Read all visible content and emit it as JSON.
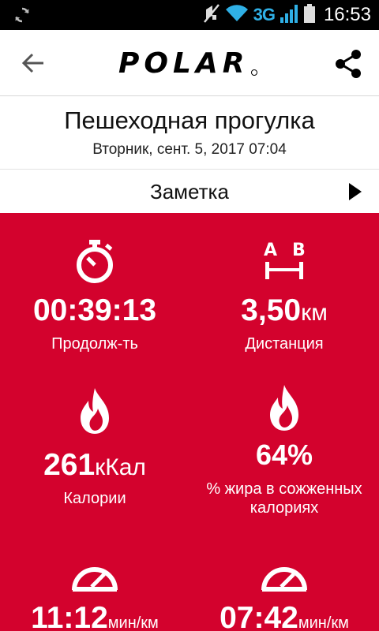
{
  "status_bar": {
    "network": "3G",
    "time": "16:53",
    "icons": [
      "sync-icon",
      "mute-icon",
      "wifi-icon",
      "signal-icon",
      "battery-icon"
    ]
  },
  "header": {
    "logo_text": "POLAR",
    "back_icon": "back-arrow-icon",
    "share_icon": "share-icon"
  },
  "session": {
    "title": "Пешеходная прогулка",
    "subtitle": "Вторник, сент. 5, 2017 07:04"
  },
  "note": {
    "label": "Заметка"
  },
  "summary": {
    "duration": {
      "value": "00:39:13",
      "label": "Продолж-ть",
      "icon": "stopwatch-icon"
    },
    "distance": {
      "value": "3,50",
      "unit": "км",
      "label": "Дистанция",
      "icon": "distance-ab-icon"
    },
    "calories": {
      "value": "261",
      "unit": "кКал",
      "label": "Калории",
      "icon": "flame-icon"
    },
    "fat_burn": {
      "value": "64%",
      "label": "% жира в сожженных калориях",
      "icon": "flame-icon"
    },
    "avg_pace": {
      "value": "11:12",
      "unit": "мин/км",
      "icon": "speedometer-icon"
    },
    "max_pace": {
      "value": "07:42",
      "unit": "мин/км",
      "icon": "speedometer-icon"
    }
  },
  "colors": {
    "brand_red": "#d3022d",
    "status_bar": "#000000",
    "network_accent": "#2fb0e6"
  }
}
